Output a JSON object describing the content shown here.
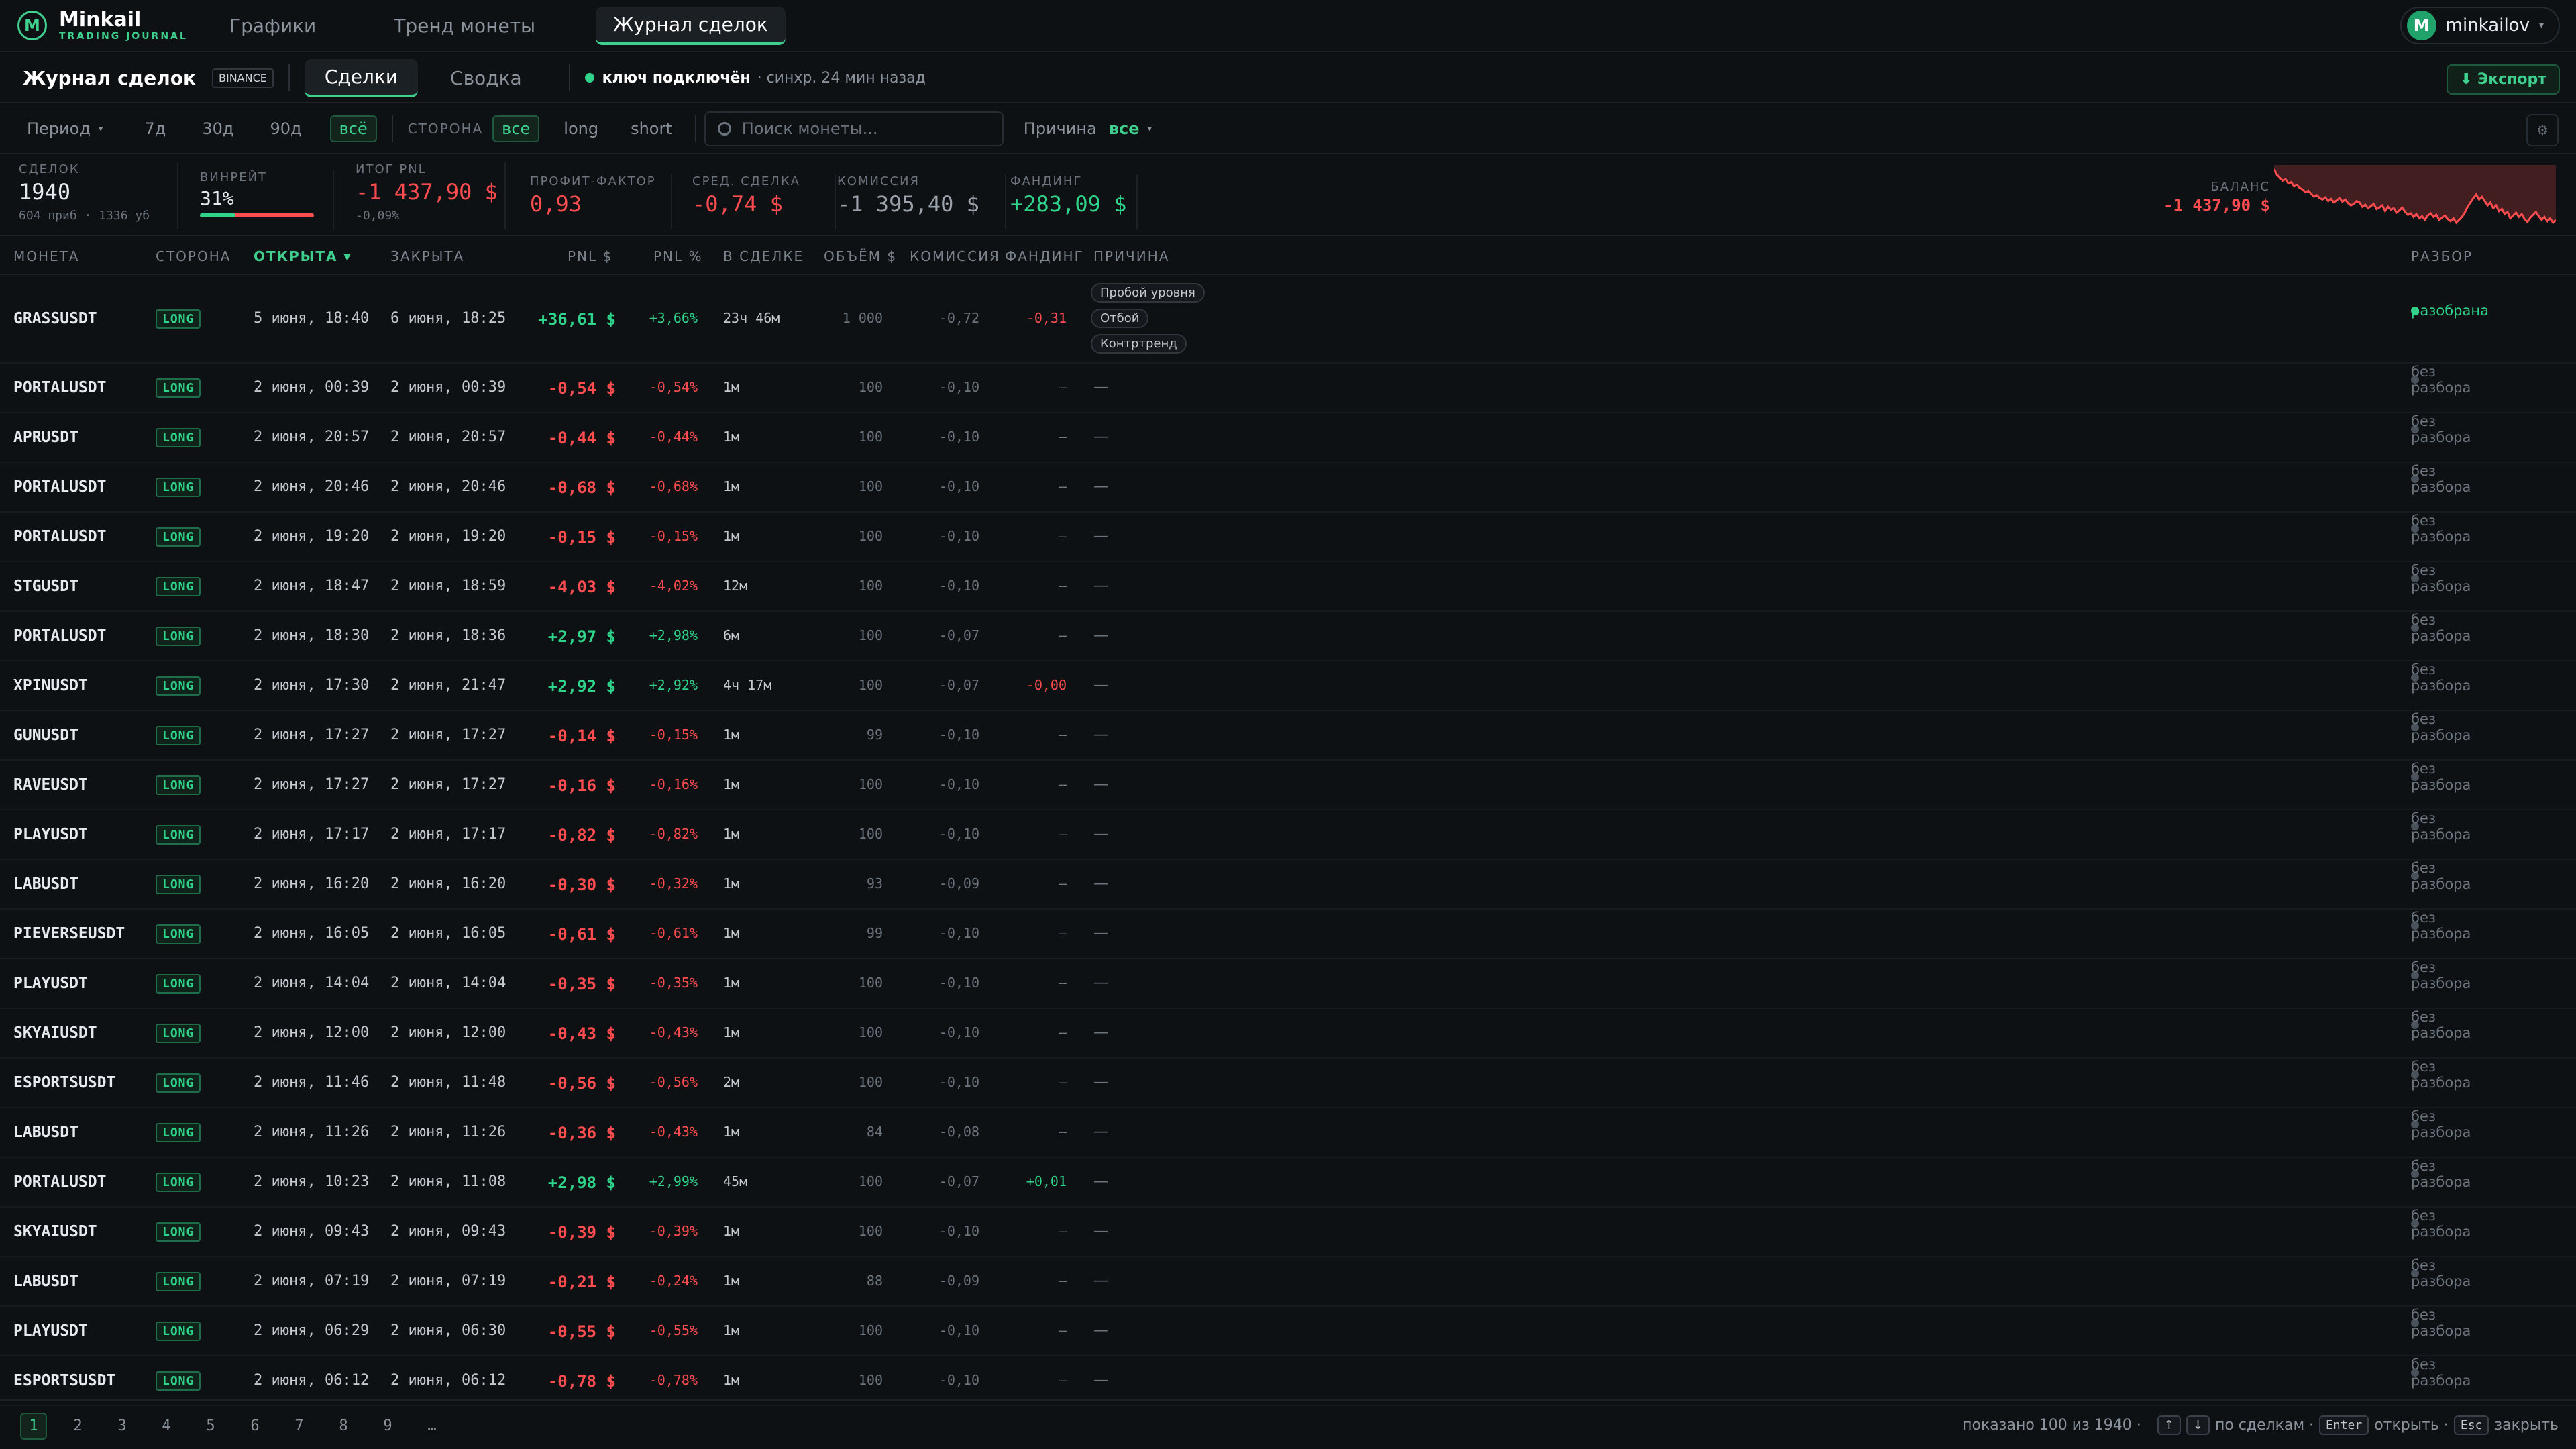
{
  "app": {
    "name": "Minkail",
    "subtitle": "TRADING JOURNAL",
    "logo_letter": "M"
  },
  "nav": {
    "tabs": [
      "Графики",
      "Тренд монеты",
      "Журнал сделок"
    ],
    "active": 2
  },
  "user": {
    "initial": "M",
    "name": "minkailov"
  },
  "subbar": {
    "title": "Журнал сделок",
    "exchange": "BINANCE",
    "tabs": [
      "Сделки",
      "Сводка"
    ],
    "status": "ключ подключён",
    "sync": "· синхр. 24 мин назад",
    "export": "⬇ Экспорт"
  },
  "filters": {
    "period_label": "Период",
    "periods": [
      "7д",
      "30д",
      "90д",
      "всё"
    ],
    "side_label": "СТОРОНА",
    "sides": [
      "все",
      "long",
      "short"
    ],
    "search_placeholder": "Поиск монеты...",
    "reason_label": "Причина",
    "reason_value": "все"
  },
  "stats": {
    "trades": {
      "label": "СДЕЛОК",
      "value": "1940",
      "sub": "604 приб · 1336 уб"
    },
    "winrate": {
      "label": "ВИНРЕЙТ",
      "value": "31%",
      "fraction": 0.31
    },
    "pnl": {
      "label": "ИТОГ PNL",
      "value": "-1 437,90 $",
      "sub": "-0,09%"
    },
    "pf": {
      "label": "ПРОФИТ-ФАКТОР",
      "value": "0,93"
    },
    "avg": {
      "label": "СРЕД. СДЕЛКА",
      "value": "-0,74 $"
    },
    "commission": {
      "label": "КОМИССИЯ",
      "value": "-1 395,40 $"
    },
    "funding": {
      "label": "ФАНДИНГ",
      "value": "+283,09 $"
    },
    "balance": {
      "label": "БАЛАНС",
      "value": "-1 437,90 $"
    }
  },
  "columns": {
    "coin": "МОНЕТА",
    "side": "СТОРОНА",
    "open": "ОТКРЫТА ▾",
    "close": "ЗАКРЫТА",
    "pnl": "PNL $",
    "pnlp": "PNL %",
    "dur": "В СДЕЛКЕ",
    "vol": "ОБЪЁМ $",
    "com": "КОМИССИЯ",
    "fund": "ФАНДИНГ",
    "reason": "ПРИЧИНА",
    "review": "РАЗБОР"
  },
  "rows": [
    {
      "coin": "GRASSUSDT",
      "side": "LONG",
      "open": "5 июня, 18:40",
      "close": "6 июня, 18:25",
      "pnl": "+36,61 $",
      "pnlp": "+3,66%",
      "dur": "23ч 46м",
      "vol": "1 000",
      "com": "-0,72",
      "fund": "-0,31",
      "reason": "",
      "tags": [
        "Пробой уровня",
        "Отбой",
        "Контртренд"
      ],
      "review": "разобрана",
      "pos": true
    },
    {
      "coin": "PORTALUSDT",
      "side": "LONG",
      "open": "2 июня, 00:39",
      "close": "2 июня, 00:39",
      "pnl": "-0,54 $",
      "pnlp": "-0,54%",
      "dur": "1м",
      "vol": "100",
      "com": "-0,10",
      "fund": "—",
      "reason": "—",
      "review": "без разбора",
      "pos": false
    },
    {
      "coin": "APRUSDT",
      "side": "LONG",
      "open": "2 июня, 20:57",
      "close": "2 июня, 20:57",
      "pnl": "-0,44 $",
      "pnlp": "-0,44%",
      "dur": "1м",
      "vol": "100",
      "com": "-0,10",
      "fund": "—",
      "reason": "—",
      "review": "без разбора",
      "pos": false
    },
    {
      "coin": "PORTALUSDT",
      "side": "LONG",
      "open": "2 июня, 20:46",
      "close": "2 июня, 20:46",
      "pnl": "-0,68 $",
      "pnlp": "-0,68%",
      "dur": "1м",
      "vol": "100",
      "com": "-0,10",
      "fund": "—",
      "reason": "—",
      "review": "без разбора",
      "pos": false
    },
    {
      "coin": "PORTALUSDT",
      "side": "LONG",
      "open": "2 июня, 19:20",
      "close": "2 июня, 19:20",
      "pnl": "-0,15 $",
      "pnlp": "-0,15%",
      "dur": "1м",
      "vol": "100",
      "com": "-0,10",
      "fund": "—",
      "reason": "—",
      "review": "без разбора",
      "pos": false
    },
    {
      "coin": "STGUSDT",
      "side": "LONG",
      "open": "2 июня, 18:47",
      "close": "2 июня, 18:59",
      "pnl": "-4,03 $",
      "pnlp": "-4,02%",
      "dur": "12м",
      "vol": "100",
      "com": "-0,10",
      "fund": "—",
      "reason": "—",
      "review": "без разбора",
      "pos": false
    },
    {
      "coin": "PORTALUSDT",
      "side": "LONG",
      "open": "2 июня, 18:30",
      "close": "2 июня, 18:36",
      "pnl": "+2,97 $",
      "pnlp": "+2,98%",
      "dur": "6м",
      "vol": "100",
      "com": "-0,07",
      "fund": "—",
      "reason": "—",
      "review": "без разбора",
      "pos": true
    },
    {
      "coin": "XPINUSDT",
      "side": "LONG",
      "open": "2 июня, 17:30",
      "close": "2 июня, 21:47",
      "pnl": "+2,92 $",
      "pnlp": "+2,92%",
      "dur": "4ч 17м",
      "vol": "100",
      "com": "-0,07",
      "fund": "-0,00",
      "reason": "—",
      "review": "без разбора",
      "pos": true
    },
    {
      "coin": "GUNUSDT",
      "side": "LONG",
      "open": "2 июня, 17:27",
      "close": "2 июня, 17:27",
      "pnl": "-0,14 $",
      "pnlp": "-0,15%",
      "dur": "1м",
      "vol": "99",
      "com": "-0,10",
      "fund": "—",
      "reason": "—",
      "review": "без разбора",
      "pos": false
    },
    {
      "coin": "RAVEUSDT",
      "side": "LONG",
      "open": "2 июня, 17:27",
      "close": "2 июня, 17:27",
      "pnl": "-0,16 $",
      "pnlp": "-0,16%",
      "dur": "1м",
      "vol": "100",
      "com": "-0,10",
      "fund": "—",
      "reason": "—",
      "review": "без разбора",
      "pos": false
    },
    {
      "coin": "PLAYUSDT",
      "side": "LONG",
      "open": "2 июня, 17:17",
      "close": "2 июня, 17:17",
      "pnl": "-0,82 $",
      "pnlp": "-0,82%",
      "dur": "1м",
      "vol": "100",
      "com": "-0,10",
      "fund": "—",
      "reason": "—",
      "review": "без разбора",
      "pos": false
    },
    {
      "coin": "LABUSDT",
      "side": "LONG",
      "open": "2 июня, 16:20",
      "close": "2 июня, 16:20",
      "pnl": "-0,30 $",
      "pnlp": "-0,32%",
      "dur": "1м",
      "vol": "93",
      "com": "-0,09",
      "fund": "—",
      "reason": "—",
      "review": "без разбора",
      "pos": false
    },
    {
      "coin": "PIEVERSEUSDT",
      "side": "LONG",
      "open": "2 июня, 16:05",
      "close": "2 июня, 16:05",
      "pnl": "-0,61 $",
      "pnlp": "-0,61%",
      "dur": "1м",
      "vol": "99",
      "com": "-0,10",
      "fund": "—",
      "reason": "—",
      "review": "без разбора",
      "pos": false
    },
    {
      "coin": "PLAYUSDT",
      "side": "LONG",
      "open": "2 июня, 14:04",
      "close": "2 июня, 14:04",
      "pnl": "-0,35 $",
      "pnlp": "-0,35%",
      "dur": "1м",
      "vol": "100",
      "com": "-0,10",
      "fund": "—",
      "reason": "—",
      "review": "без разбора",
      "pos": false
    },
    {
      "coin": "SKYAIUSDT",
      "side": "LONG",
      "open": "2 июня, 12:00",
      "close": "2 июня, 12:00",
      "pnl": "-0,43 $",
      "pnlp": "-0,43%",
      "dur": "1м",
      "vol": "100",
      "com": "-0,10",
      "fund": "—",
      "reason": "—",
      "review": "без разбора",
      "pos": false
    },
    {
      "coin": "ESPORTSUSDT",
      "side": "LONG",
      "open": "2 июня, 11:46",
      "close": "2 июня, 11:48",
      "pnl": "-0,56 $",
      "pnlp": "-0,56%",
      "dur": "2м",
      "vol": "100",
      "com": "-0,10",
      "fund": "—",
      "reason": "—",
      "review": "без разбора",
      "pos": false
    },
    {
      "coin": "LABUSDT",
      "side": "LONG",
      "open": "2 июня, 11:26",
      "close": "2 июня, 11:26",
      "pnl": "-0,36 $",
      "pnlp": "-0,43%",
      "dur": "1м",
      "vol": "84",
      "com": "-0,08",
      "fund": "—",
      "reason": "—",
      "review": "без разбора",
      "pos": false
    },
    {
      "coin": "PORTALUSDT",
      "side": "LONG",
      "open": "2 июня, 10:23",
      "close": "2 июня, 11:08",
      "pnl": "+2,98 $",
      "pnlp": "+2,99%",
      "dur": "45м",
      "vol": "100",
      "com": "-0,07",
      "fund": "+0,01",
      "reason": "—",
      "review": "без разбора",
      "pos": true
    },
    {
      "coin": "SKYAIUSDT",
      "side": "LONG",
      "open": "2 июня, 09:43",
      "close": "2 июня, 09:43",
      "pnl": "-0,39 $",
      "pnlp": "-0,39%",
      "dur": "1м",
      "vol": "100",
      "com": "-0,10",
      "fund": "—",
      "reason": "—",
      "review": "без разбора",
      "pos": false
    },
    {
      "coin": "LABUSDT",
      "side": "LONG",
      "open": "2 июня, 07:19",
      "close": "2 июня, 07:19",
      "pnl": "-0,21 $",
      "pnlp": "-0,24%",
      "dur": "1м",
      "vol": "88",
      "com": "-0,09",
      "fund": "—",
      "reason": "—",
      "review": "без разбора",
      "pos": false
    },
    {
      "coin": "PLAYUSDT",
      "side": "LONG",
      "open": "2 июня, 06:29",
      "close": "2 июня, 06:30",
      "pnl": "-0,55 $",
      "pnlp": "-0,55%",
      "dur": "1м",
      "vol": "100",
      "com": "-0,10",
      "fund": "—",
      "reason": "—",
      "review": "без разбора",
      "pos": false
    },
    {
      "coin": "ESPORTSUSDT",
      "side": "LONG",
      "open": "2 июня, 06:12",
      "close": "2 июня, 06:12",
      "pnl": "-0,78 $",
      "pnlp": "-0,78%",
      "dur": "1м",
      "vol": "100",
      "com": "-0,10",
      "fund": "—",
      "reason": "—",
      "review": "без разбора",
      "pos": false
    }
  ],
  "pagination": {
    "pages": [
      "1",
      "2",
      "3",
      "4",
      "5",
      "6",
      "7",
      "8",
      "9",
      "…"
    ],
    "active": 0,
    "shown": "показано 100 из 1940 ·",
    "nav_hint": "по сделкам ·",
    "enter_key": "Enter",
    "enter_hint": "открыть ·",
    "esc_key": "Esc",
    "esc_hint": "закрыть"
  },
  "colors": {
    "accent": "#3fcf8e",
    "positive": "#2fd38a",
    "negative": "#ff4d4f",
    "background": "#0e1114"
  },
  "balance_spark": [
    -20,
    -28,
    -32,
    -36,
    -34,
    -40,
    -38,
    -44,
    -42,
    -46,
    -48,
    -52,
    -50,
    -54,
    -58,
    -56,
    -60,
    -62,
    -59,
    -64,
    -61,
    -66,
    -63,
    -60,
    -65,
    -62,
    -67,
    -70,
    -68,
    -64,
    -66,
    -72,
    -69,
    -74,
    -71,
    -68,
    -75,
    -73,
    -70,
    -78,
    -72,
    -76,
    -74,
    -80,
    -77,
    -73,
    -79,
    -83,
    -81,
    -86,
    -82,
    -88,
    -85,
    -90,
    -84,
    -81,
    -86,
    -83,
    -90,
    -87,
    -84,
    -89,
    -92,
    -88,
    -94,
    -90,
    -86,
    -80,
    -72,
    -66,
    -60,
    -55,
    -62,
    -58,
    -64,
    -70,
    -66,
    -74,
    -70,
    -78,
    -75,
    -82,
    -79,
    -88,
    -84,
    -80,
    -86,
    -82,
    -89,
    -93,
    -87,
    -83,
    -79,
    -85,
    -90,
    -86,
    -92,
    -88,
    -94,
    -90
  ]
}
